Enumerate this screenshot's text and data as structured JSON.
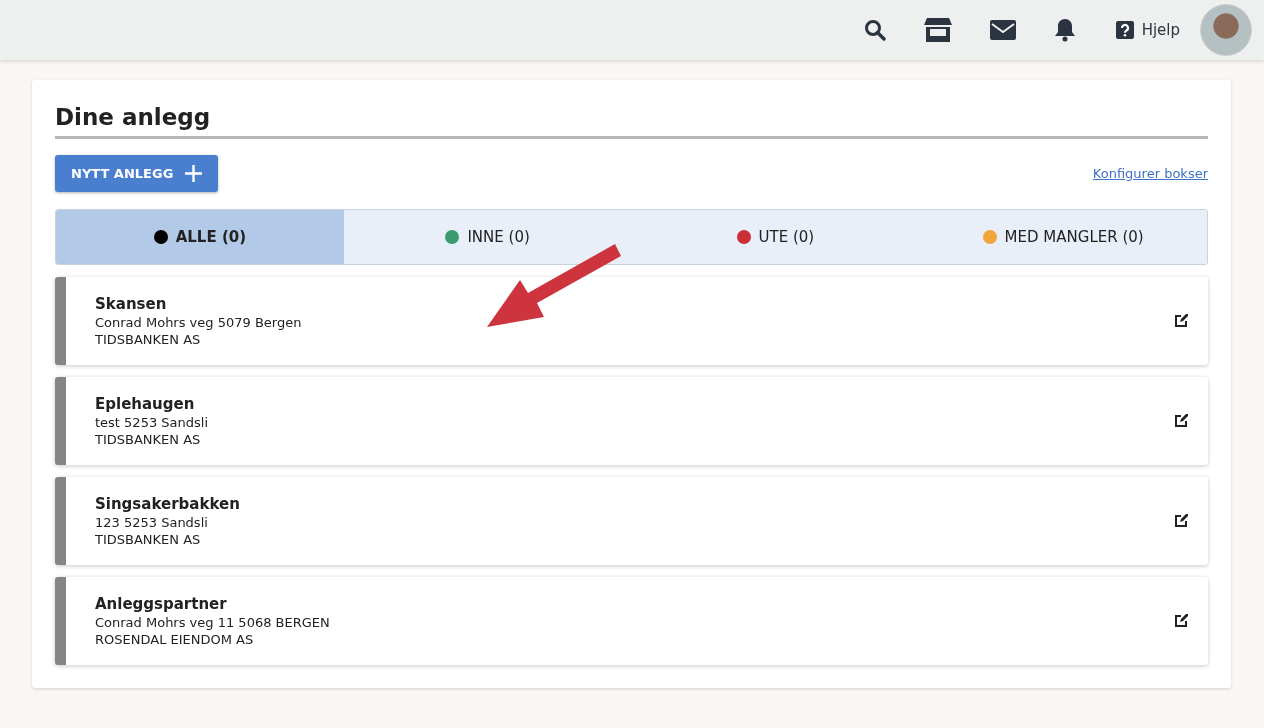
{
  "topbar": {
    "help_label": "Hjelp"
  },
  "page": {
    "title": "Dine anlegg",
    "new_button": "NYTT ANLEGG",
    "configure_link": "Konfigurer bokser"
  },
  "filters": [
    {
      "label": "ALLE (0)",
      "color": "#000000",
      "selected": true
    },
    {
      "label": "INNE (0)",
      "color": "#3a9b6e",
      "selected": false
    },
    {
      "label": "UTE (0)",
      "color": "#cc2e36",
      "selected": false
    },
    {
      "label": "MED MANGLER (0)",
      "color": "#f2a53a",
      "selected": false
    }
  ],
  "facilities": [
    {
      "name": "Skansen",
      "address": "Conrad Mohrs veg 5079 Bergen",
      "company": "TIDSBANKEN AS"
    },
    {
      "name": "Eplehaugen",
      "address": "test 5253 Sandsli",
      "company": "TIDSBANKEN AS"
    },
    {
      "name": "Singsakerbakken",
      "address": "123 5253 Sandsli",
      "company": "TIDSBANKEN AS"
    },
    {
      "name": "Anleggspartner",
      "address": "Conrad Mohrs veg 11 5068 BERGEN",
      "company": "ROSENDAL EIENDOM AS"
    }
  ]
}
